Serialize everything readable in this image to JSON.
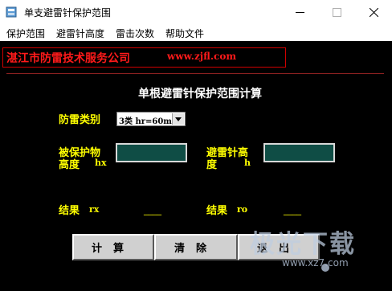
{
  "window": {
    "title": "单支避雷针保护范围",
    "controls": [
      "minimize",
      "maximize",
      "close"
    ]
  },
  "menu": [
    "保护范围",
    "避雷针高度",
    "雷击次数",
    "帮助文件"
  ],
  "company": {
    "name": "湛江市防雷技术服务公司",
    "url": "www.zjfl.com"
  },
  "heading": "单根避雷针保护范围计算",
  "lightning_class": {
    "label": "防雷类别",
    "selected": "3类 hr=60m"
  },
  "inputs": {
    "protected_height_label_line1": "被保护物",
    "protected_height_label_line2": "高度",
    "protected_height_symbol": "hx",
    "protected_height_value": "",
    "rod_height_label_line1": "避雷针高",
    "rod_height_label_line2": "度",
    "rod_height_symbol": "h",
    "rod_height_value": ""
  },
  "results": {
    "label": "结果",
    "rx_symbol": "rx",
    "rx_value": "____",
    "ro_symbol": "ro",
    "ro_value": "____"
  },
  "buttons": {
    "calculate": "计算",
    "clear": "清除",
    "exit": "退出"
  },
  "watermark": {
    "text": "极光下载",
    "url": "www.xz7.com"
  },
  "colors": {
    "client_background": "#000000",
    "company_text": "#ff1a1a",
    "label_text": "#ffff00",
    "input_fill": "#0f4d45",
    "button_face": "#d0d0d0"
  }
}
